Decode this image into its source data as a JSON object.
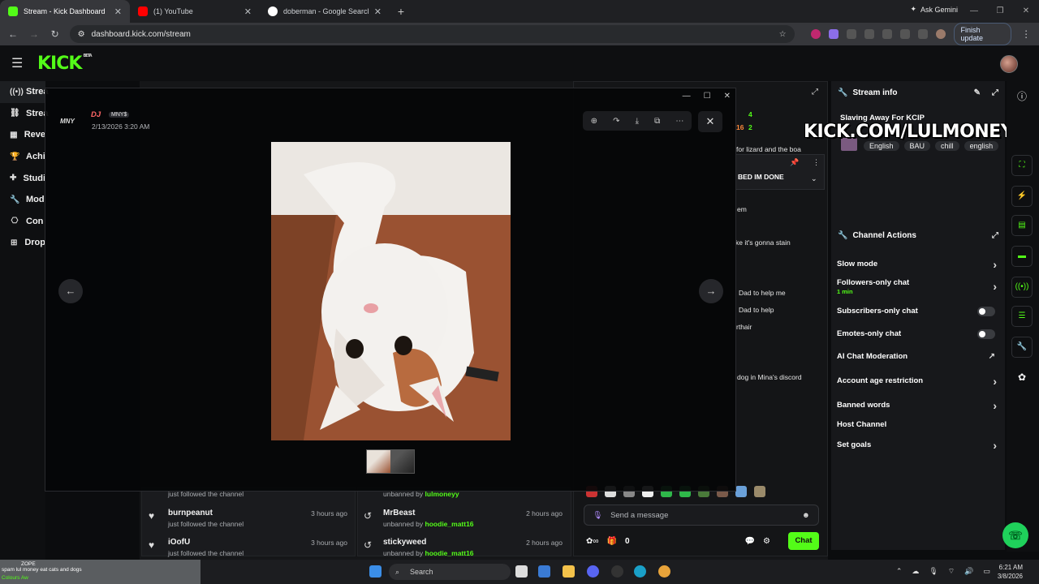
{
  "browser": {
    "tabs": [
      {
        "title": "Stream - Kick Dashboard",
        "active": true,
        "favicon_color": "#53fc18"
      },
      {
        "title": "(1) YouTube",
        "active": false,
        "favicon_color": "#ff0000"
      },
      {
        "title": "doberman - Google Search",
        "active": false,
        "favicon_color": "#ffffff"
      }
    ],
    "new_tab_label": "+",
    "gemini_label": "Ask Gemini",
    "url": "dashboard.kick.com/stream",
    "finish_update_label": "Finish update"
  },
  "kick": {
    "logo": "KICK",
    "beta": "BETA"
  },
  "leftnav": [
    {
      "label": "Strea",
      "icon": "broadcast-icon"
    },
    {
      "label": "Strea",
      "icon": "link-icon"
    },
    {
      "label": "Reve",
      "icon": "chart-icon"
    },
    {
      "label": "Achi",
      "icon": "trophy-icon"
    },
    {
      "label": "Studi",
      "icon": "puzzle-icon"
    },
    {
      "label": "Mod",
      "icon": "wrench-icon"
    },
    {
      "label": "Con",
      "icon": "network-icon"
    },
    {
      "label": "Drop",
      "icon": "tree-icon"
    }
  ],
  "activity": {
    "left": [
      {
        "name": "",
        "sub": "just followed the channel",
        "time": ""
      },
      {
        "name": "burnpeanut",
        "sub": "just followed the channel",
        "time": "3 hours ago"
      },
      {
        "name": "iOofU",
        "sub": "just followed the channel",
        "time": "3 hours ago"
      }
    ],
    "right": [
      {
        "name": "",
        "sub_prefix": "unbanned by",
        "by": "lulmoneyy",
        "time": ""
      },
      {
        "name": "MrBeast",
        "sub_prefix": "unbanned by",
        "by": "hoodie_matt16",
        "time": "2 hours ago"
      },
      {
        "name": "stickyweed",
        "sub_prefix": "unbanned by",
        "by": "hoodie_matt16",
        "time": "2 hours ago"
      }
    ]
  },
  "chat": {
    "top_counts": [
      "4",
      "2"
    ],
    "top_user_fragment": "16",
    "messages": [
      "for lizard and the boa",
      "em",
      "ke it's gonna stain",
      "Dad to help me",
      "Dad to help",
      "rthair",
      "dog in Mina's discord"
    ],
    "pinned_text": "BED IM DONE",
    "input_placeholder": "Send a message",
    "footer_count": "0",
    "chat_button": "Chat"
  },
  "stream_info": {
    "header": "Stream info",
    "title": "Slaving Away For KCIP",
    "tags": [
      "English",
      "BAU",
      "chill",
      "english"
    ],
    "overlay_text": "KICK.COM/LULMONEYY"
  },
  "channel_actions": {
    "header": "Channel Actions",
    "items": [
      {
        "label": "Slow mode",
        "control": "arrow"
      },
      {
        "label": "Followers-only chat",
        "sub": "1 min",
        "control": "arrow"
      },
      {
        "label": "Subscribers-only chat",
        "control": "toggle"
      },
      {
        "label": "Emotes-only chat",
        "control": "toggle"
      },
      {
        "label": "AI Chat Moderation",
        "control": "external"
      },
      {
        "label": "Account age restriction",
        "control": "arrow"
      },
      {
        "label": "Banned words",
        "control": "arrow"
      },
      {
        "label": "Host Channel",
        "control": "none"
      },
      {
        "label": "Set goals",
        "control": "arrow"
      }
    ]
  },
  "modal": {
    "avatar_text": "MNY",
    "username": "DJ",
    "role": "MNY$",
    "date": "2/13/2026 3:20 AM"
  },
  "ticker": {
    "line1": "ZOPE",
    "line2": "spam lul money eat cats and dogs",
    "line3": "Colours Aw"
  },
  "taskbar": {
    "search_label": "Search",
    "time": "6:21 AM",
    "date": "3/8/2026"
  }
}
